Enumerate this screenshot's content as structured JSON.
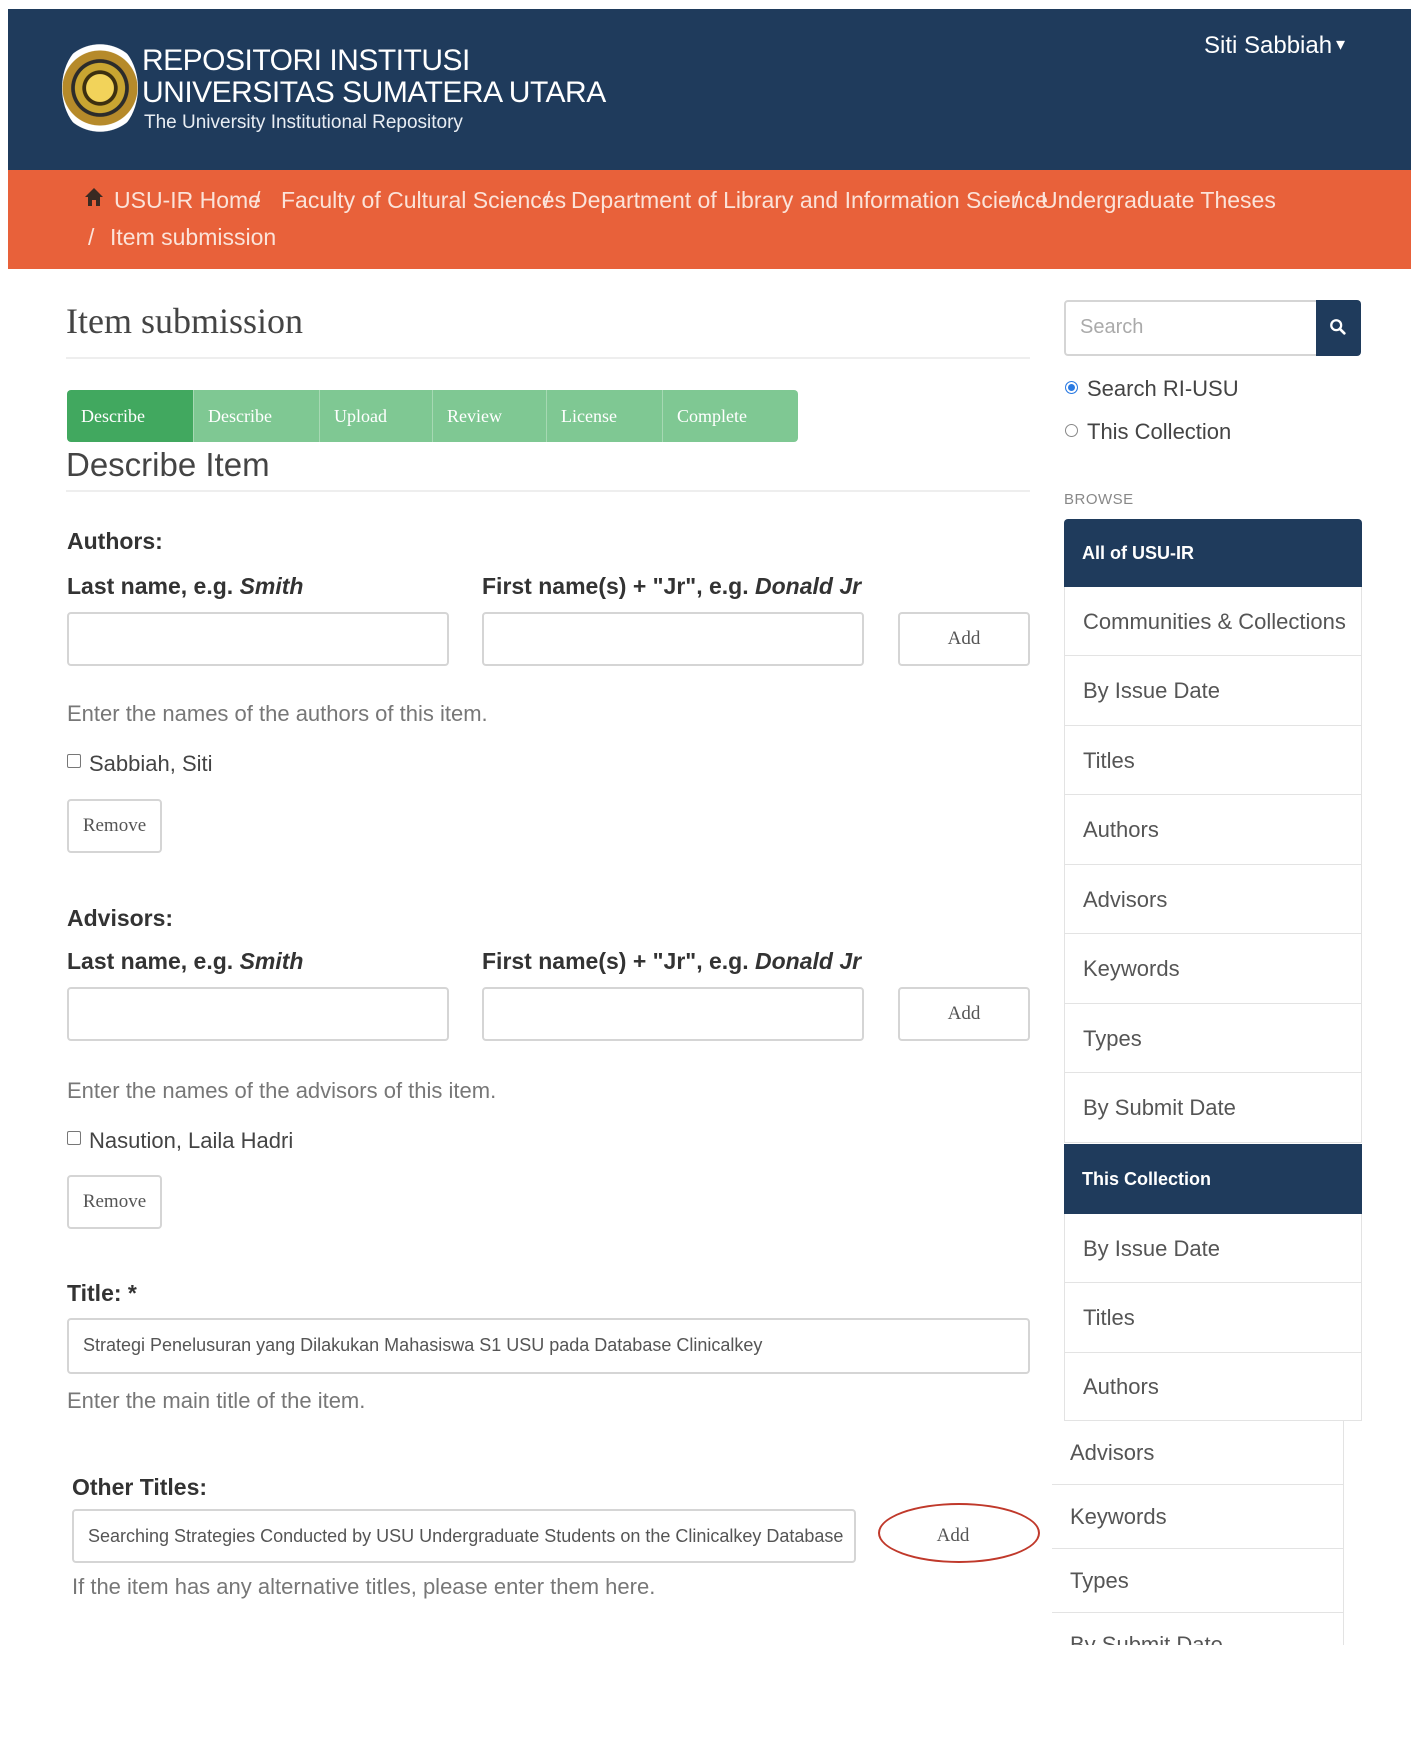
{
  "header": {
    "title_line1": "REPOSITORI INSTITUSI",
    "title_line2": "UNIVERSITAS SUMATERA UTARA",
    "subtitle": "The University Institutional Repository",
    "user_name": "Siti Sabbiah",
    "user_caret": "▾"
  },
  "breadcrumb": {
    "items": [
      "USU-IR Home",
      "Faculty of Cultural Sciences",
      "Department of Library and Information Science",
      "Undergraduate Theses",
      "Item submission"
    ],
    "separator": "/"
  },
  "main": {
    "page_title": "Item submission",
    "steps": [
      "Describe",
      "Describe",
      "Upload",
      "Review",
      "License",
      "Complete"
    ],
    "section_title": "Describe Item",
    "authors": {
      "label": "Authors:",
      "last_name_label_prefix": "Last name, e.g. ",
      "last_name_label_example": "Smith",
      "first_name_label_prefix": "First name(s) + \"Jr\", e.g. ",
      "first_name_label_example": "Donald Jr",
      "last_name_value": "",
      "first_name_value": "",
      "add_label": "Add",
      "help": "Enter the names of the authors of this item.",
      "entry": "Sabbiah, Siti",
      "remove_label": "Remove"
    },
    "advisors": {
      "label": "Advisors:",
      "last_name_label_prefix": "Last name, e.g. ",
      "last_name_label_example": "Smith",
      "first_name_label_prefix": "First name(s) + \"Jr\", e.g. ",
      "first_name_label_example": "Donald Jr",
      "last_name_value": "",
      "first_name_value": "",
      "add_label": "Add",
      "help": "Enter the names of the advisors of this item.",
      "entry": "Nasution, Laila Hadri",
      "remove_label": "Remove"
    },
    "title": {
      "label": "Title: *",
      "value": "Strategi Penelusuran yang Dilakukan Mahasiswa S1 USU pada Database Clinicalkey",
      "help": "Enter the main title of the item."
    },
    "other_titles": {
      "label": "Other Titles:",
      "value": "Searching Strategies Conducted by USU Undergraduate Students on the Clinicalkey Database",
      "add_label": "Add",
      "help": "If the item has any alternative titles, please enter them here."
    }
  },
  "sidebar": {
    "search_placeholder": "Search",
    "scope_options": [
      "Search RI-USU",
      "This Collection"
    ],
    "browse_heading": "BROWSE",
    "all_heading": "All of USU-IR",
    "all_items": [
      "Communities & Collections",
      "By Issue Date",
      "Titles",
      "Authors",
      "Advisors",
      "Keywords",
      "Types",
      "By Submit Date"
    ],
    "collection_heading": "This Collection",
    "collection_items": [
      "By Issue Date",
      "Titles",
      "Authors",
      "Advisors",
      "Keywords",
      "Types",
      "By Submit Date"
    ]
  },
  "colors": {
    "header_bg": "#1f3b5c",
    "breadcrumb_bg": "#e8613a",
    "step_active": "#41a85f",
    "step_pending": "#7fc893",
    "highlight_circle": "#c0392b"
  }
}
